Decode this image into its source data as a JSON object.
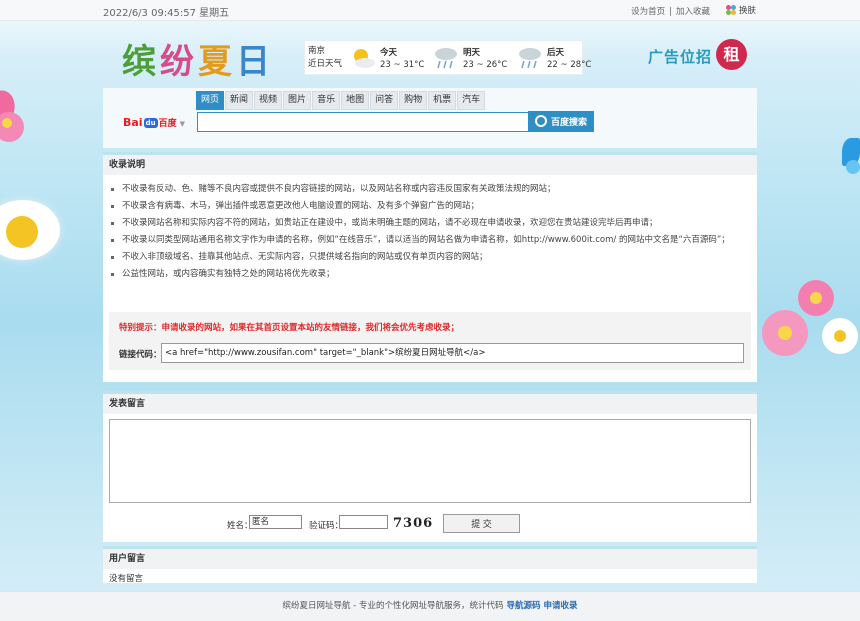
{
  "topbar": {
    "datetime": "2022/6/3 09:45:57 星期五",
    "set_home": "设为首页",
    "separator": "|",
    "bookmark": "加入收藏",
    "skin": "换肤"
  },
  "header": {
    "logo": [
      "缤",
      "纷",
      "夏",
      "日"
    ],
    "weather": {
      "city": "南京",
      "city_sub": "近日天气",
      "days": [
        {
          "name": "今天",
          "temp": "23 ~ 31°C",
          "icon": "sunny-cloudy-icon"
        },
        {
          "name": "明天",
          "temp": "23 ~ 26°C",
          "icon": "rain-icon"
        },
        {
          "name": "后天",
          "temp": "22 ~ 28°C",
          "icon": "rain-icon"
        }
      ]
    },
    "ad_text": "广告位招",
    "ad_badge": "租"
  },
  "search": {
    "tabs": [
      "网页",
      "新闻",
      "视频",
      "图片",
      "音乐",
      "地图",
      "问答",
      "购物",
      "机票",
      "汽车"
    ],
    "active_tab": 0,
    "engine_a": "Bai",
    "engine_paw": "du",
    "engine_b": "百度",
    "input_value": "",
    "button": "百度搜索"
  },
  "rules": {
    "title": "收录说明",
    "items": [
      "不收录有反动、色、赌等不良内容或提供不良内容链接的网站，以及网站名称或内容违反国家有关政策法规的网站；",
      "不收录含有病毒、木马，弹出插件或恶意更改他人电脑设置的网站、及有多个弹窗广告的网站；",
      "不收录网站名称和实际内容不符的网站，如贵站正在建设中，或尚未明确主题的网站，请不必现在申请收录，欢迎您在贵站建设完毕后再申请；",
      "不收录以同类型网站通用名称文字作为申请的名称，例如“在线音乐”，请以适当的网站名做为申请名称，如http://www.600it.com/ 的网站中文名是“六百源码”；",
      "不收入非顶级域名、挂靠其他站点、无实际内容，只提供域名指向的网站或仅有单页内容的网站；",
      "公益性网站，或内容确实有独特之处的网站将优先收录；"
    ],
    "tip": "特别提示：申请收录的网站，如果在其首页设置本站的友情链接，我们将会优先考虑收录；",
    "code_label": "链接代码：",
    "code_value": "<a href=\"http://www.zousifan.com\" target=\"_blank\">缤纷夏日网址导航</a>"
  },
  "message": {
    "title": "发表留言",
    "name_label": "姓名：",
    "name_value": "匿名",
    "captcha_label": "验证码：",
    "captcha_text": "7306",
    "submit": "提 交"
  },
  "users": {
    "title": "用户留言",
    "empty": "没有留言"
  },
  "footer": {
    "text": "缤纷夏日网址导航 - 专业的个性化网址导航服务，统计代码",
    "link1": "导航源码",
    "link2": "申请收录"
  }
}
